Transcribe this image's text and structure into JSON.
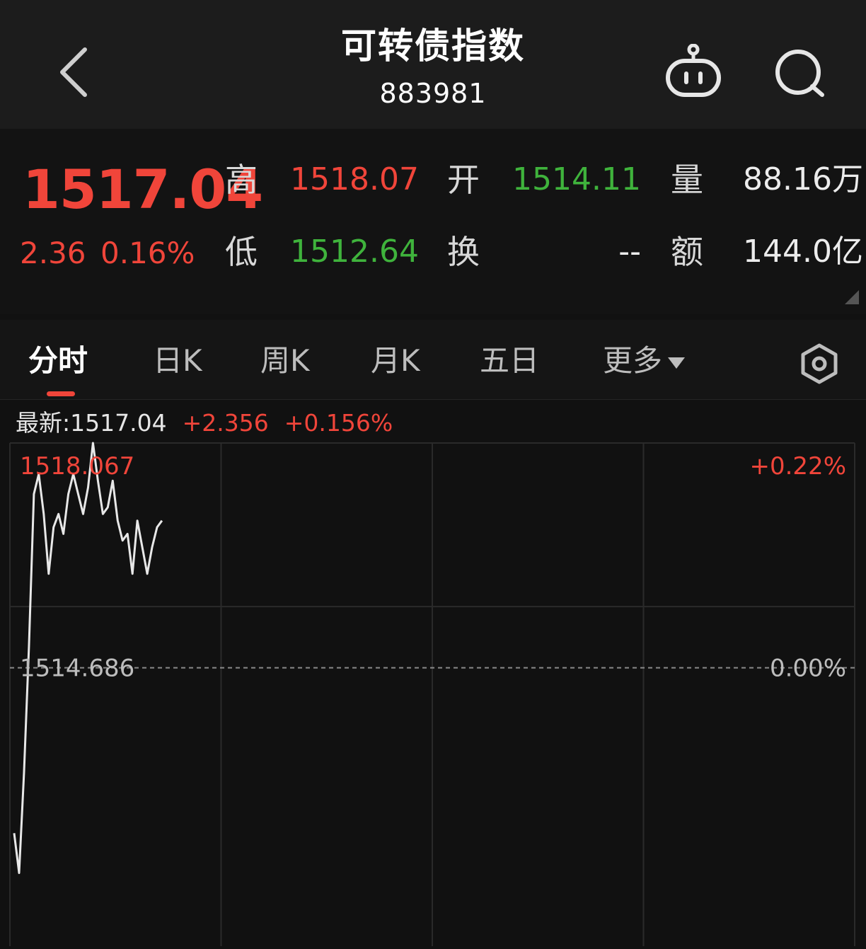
{
  "header": {
    "title": "可转债指数",
    "code": "883981",
    "icons": [
      "back-arrow-icon",
      "robot-icon",
      "search-icon"
    ]
  },
  "quote": {
    "price": "1517.04",
    "change": "2.36",
    "change_pct": "0.16%",
    "high_label": "高",
    "high": "1518.07",
    "open_label": "开",
    "open": "1514.11",
    "volume_label": "量",
    "volume": "88.16万",
    "low_label": "低",
    "low": "1512.64",
    "turnover_label": "换",
    "turnover": "--",
    "amount_label": "额",
    "amount": "144.0亿"
  },
  "tabs": [
    {
      "label": "分时"
    },
    {
      "label": "日K"
    },
    {
      "label": "周K"
    },
    {
      "label": "月K"
    },
    {
      "label": "五日"
    },
    {
      "label": "更多"
    }
  ],
  "info": {
    "latest_label": "最新:1517.04",
    "change": "+2.356",
    "change_pct": "+0.156%"
  },
  "colors": {
    "up": "#f0453a",
    "down": "#3fb33c",
    "background": "#111111",
    "line": "#e8e8e8"
  },
  "chart_data": {
    "type": "line",
    "top_left_label": "1518.067",
    "top_right_label": "+0.22%",
    "base_left_label": "1514.686",
    "base_right_label": "0.00%",
    "ylim": [
      1510.5,
      1518.067
    ],
    "prev_close": 1514.686,
    "session_points_total": 241,
    "series": [
      {
        "values": [
          1512.2,
          1511.6,
          1513.1,
          1515.0,
          1517.3,
          1517.6,
          1517.0,
          1516.1,
          1516.8,
          1517.0,
          1516.7,
          1517.3,
          1517.6,
          1517.3,
          1517.0,
          1517.4,
          1518.067,
          1517.5,
          1517.0,
          1517.1,
          1517.5,
          1516.9,
          1516.6,
          1516.7,
          1516.1,
          1516.9,
          1516.5,
          1516.1,
          1516.5,
          1516.8,
          1516.9
        ]
      }
    ]
  }
}
